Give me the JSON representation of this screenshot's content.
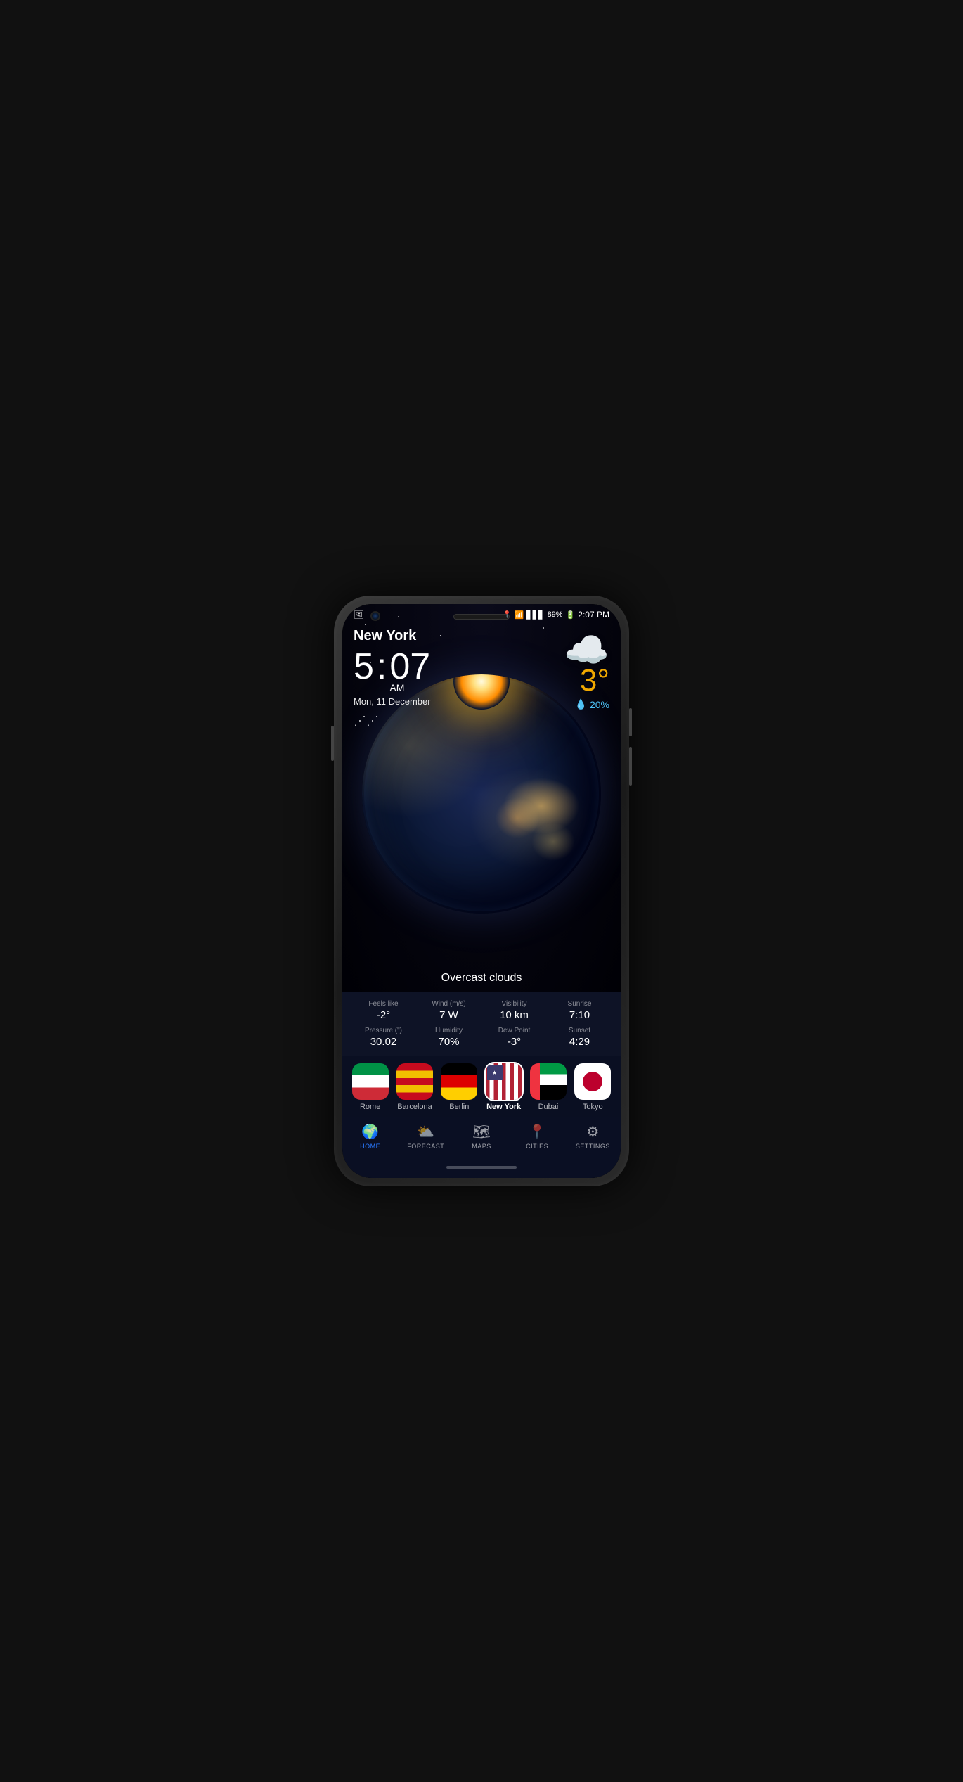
{
  "phone": {
    "status_bar": {
      "left_icon": "📷",
      "location_icon": "📍",
      "wifi_icon": "wifi",
      "signal_icon": "signal",
      "battery": "89%",
      "time": "2:07 PM"
    }
  },
  "weather": {
    "city": "New York",
    "time_hour": "5",
    "time_colon": ":",
    "time_minutes": "07",
    "time_ampm": "AM",
    "date": "Mon, 11 December",
    "temperature": "3°",
    "precipitation": "20%",
    "condition": "Overcast clouds",
    "details": {
      "feels_like_label": "Feels like",
      "feels_like_value": "-2°",
      "wind_label": "Wind (m/s)",
      "wind_value": "7 W",
      "visibility_label": "Visibility",
      "visibility_value": "10 km",
      "sunrise_label": "Sunrise",
      "sunrise_value": "7:10",
      "pressure_label": "Pressure (\")",
      "pressure_value": "30.02",
      "humidity_label": "Humidity",
      "humidity_value": "70%",
      "dew_label": "Dew Point",
      "dew_value": "-3°",
      "sunset_label": "Sunset",
      "sunset_value": "4:29"
    }
  },
  "cities": [
    {
      "name": "Rome",
      "flag_class": "city-flag-rome",
      "active": false
    },
    {
      "name": "Barcelona",
      "flag_class": "city-flag-barcelona",
      "active": false
    },
    {
      "name": "Berlin",
      "flag_class": "city-flag-berlin",
      "active": false
    },
    {
      "name": "New York",
      "flag_class": "city-flag-newyork",
      "active": true
    },
    {
      "name": "Dubai",
      "flag_class": "city-flag-dubai",
      "active": false
    },
    {
      "name": "Tokyo",
      "flag_class": "city-flag-tokyo",
      "active": false
    }
  ],
  "nav": [
    {
      "id": "home",
      "icon": "🌍",
      "label": "HOME",
      "active": true
    },
    {
      "id": "forecast",
      "icon": "⛅",
      "label": "FORECAST",
      "active": false
    },
    {
      "id": "maps",
      "icon": "🗺",
      "label": "MAPS",
      "active": false
    },
    {
      "id": "cities",
      "icon": "📍",
      "label": "CITIES",
      "active": false
    },
    {
      "id": "settings",
      "icon": "⚙",
      "label": "SETTINGS",
      "active": false
    }
  ]
}
